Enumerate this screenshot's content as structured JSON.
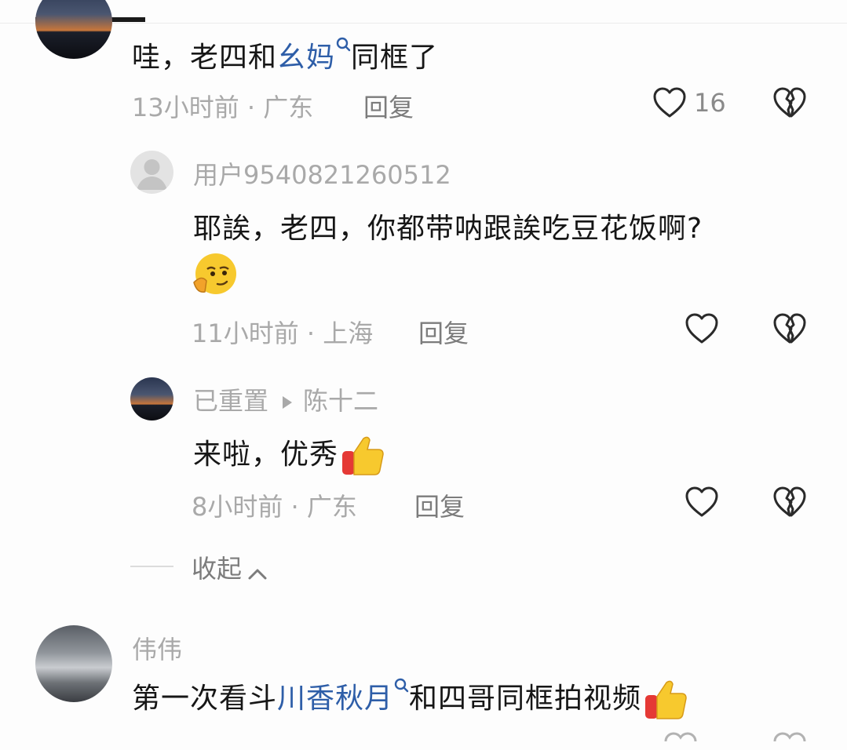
{
  "comments": [
    {
      "parts": [
        "哇，老四和",
        "幺妈",
        "同框了"
      ],
      "time": "13小时前",
      "location": "广东",
      "reply": "回复",
      "likes": "16"
    },
    {
      "username": "用户9540821260512",
      "text": "耶誒，老四，你都带呐跟誒吃豆花饭啊?",
      "time": "11小时前",
      "location": "上海",
      "reply": "回复"
    },
    {
      "username": "已重置",
      "reply_to": "陈十二",
      "text": "来啦，优秀",
      "time": "8小时前",
      "location": "广东",
      "reply": "回复"
    },
    {
      "username": "伟伟",
      "parts": [
        "第一次看斗",
        "川香秋月",
        "和四哥同框拍视频"
      ]
    }
  ],
  "collapse_label": "收起",
  "separator": "·"
}
